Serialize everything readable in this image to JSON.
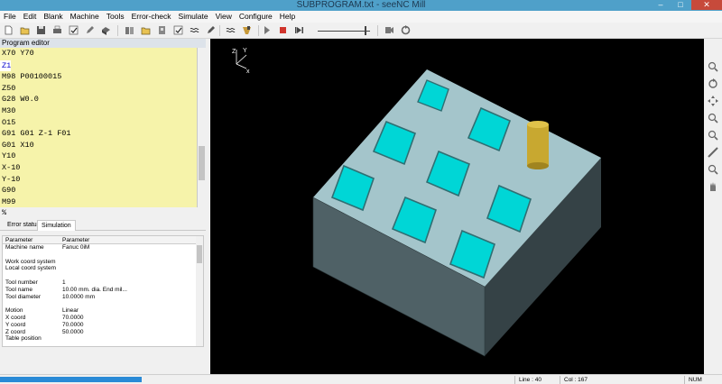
{
  "window": {
    "title": "SUBPROGRAM.txt - seeNC Mill",
    "min": "–",
    "max": "□",
    "close": "✕"
  },
  "menu": [
    "File",
    "Edit",
    "Blank",
    "Machine",
    "Tools",
    "Error-check",
    "Simulate",
    "View",
    "Configure",
    "Help"
  ],
  "program_editor": {
    "title": "Program editor",
    "lines": [
      "X70 Y70",
      "Z1",
      "M98 P00100015",
      "Z50",
      "G28 W0.0",
      "M30",
      "O15",
      "G91 G01 Z-1 F01",
      "G01 X10",
      "Y10",
      "X-10",
      "Y-10",
      "G90",
      "M99",
      "%"
    ],
    "selected_line": "Z1"
  },
  "tabs": [
    "Error status",
    "Simulation"
  ],
  "simulation_table": {
    "headers": [
      "Parameter",
      "Parameter"
    ],
    "rows": [
      [
        "Machine name",
        "Fanuc 0iM"
      ],
      [
        "",
        ""
      ],
      [
        "Work coord system",
        ""
      ],
      [
        "Local coord system",
        ""
      ],
      [
        "",
        ""
      ],
      [
        "Tool number",
        "1"
      ],
      [
        "Tool name",
        "10.00 mm. dia. End mil..."
      ],
      [
        "Tool diameter",
        "10.0000    mm"
      ],
      [
        "",
        ""
      ],
      [
        "Motion",
        "Linear"
      ],
      [
        "X coord",
        "70.0000"
      ],
      [
        "Y coord",
        "70.0000"
      ],
      [
        "Z coord",
        "50.0000"
      ],
      [
        "Table position",
        ""
      ]
    ]
  },
  "axis_labels": {
    "x": "x",
    "y": "Y",
    "z": "Z"
  },
  "status": {
    "line": "Line : 40",
    "col": "Col : 167",
    "num": "NUM",
    "progress": 0.2
  },
  "colors": {
    "editor_bg": "#f6f3aa",
    "block_top": "#a8c8cc",
    "pocket": "#00d6d6",
    "tool": "#c8a830",
    "viewport_bg": "#000000"
  },
  "toolbar_icons": [
    "new-icon",
    "open-icon",
    "save-icon",
    "print-icon",
    "check-icon",
    "edit-icon",
    "blank-icon",
    "machine-icon",
    "open-blank-icon",
    "load-tool-icon",
    "settings-icon",
    "wave-icon",
    "simulate-icon",
    "play-icon",
    "stop-icon",
    "step-icon",
    "speed-slider",
    "cam-icon",
    "reset-icon"
  ],
  "right_tool_icons": [
    "zoom-fit-icon",
    "rotate-icon",
    "pan-icon",
    "zoom-in-icon",
    "zoom-out-icon",
    "measure-icon",
    "zoom-box-icon",
    "hand-icon"
  ]
}
